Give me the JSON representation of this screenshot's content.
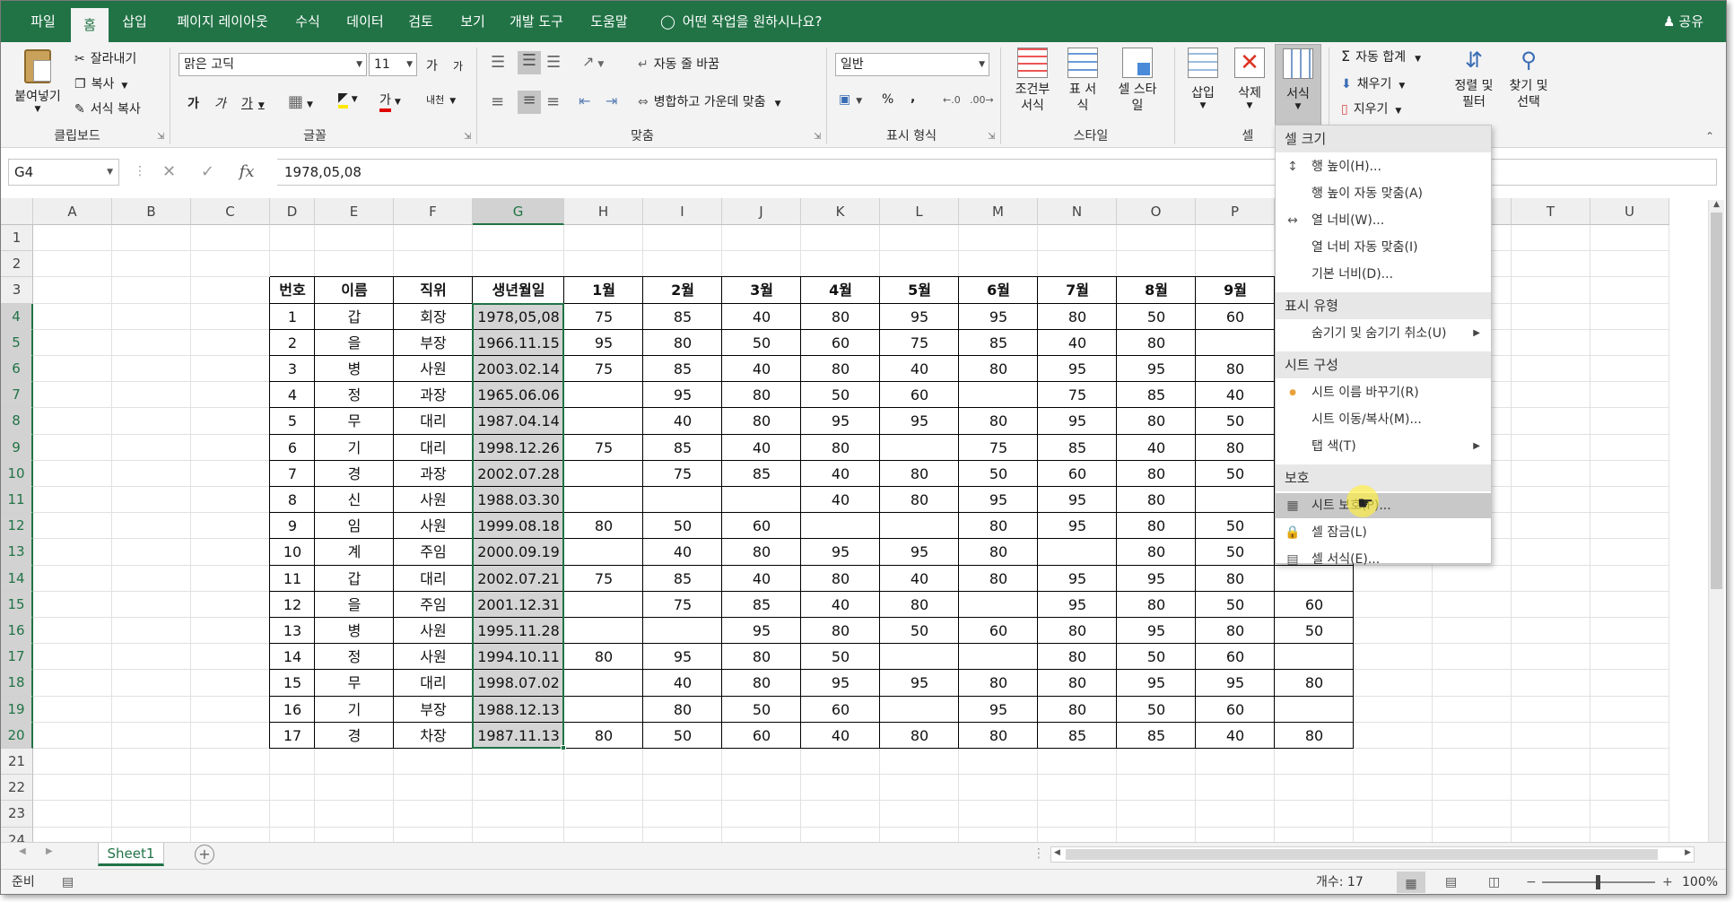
{
  "ribbon_tabs": [
    "파일",
    "홈",
    "삽입",
    "페이지 레이아웃",
    "수식",
    "데이터",
    "검토",
    "보기",
    "개발 도구",
    "도움말"
  ],
  "active_tab": "홈",
  "tell_me": "어떤 작업을 원하시나요?",
  "share": "공유",
  "clipboard": {
    "paste": "붙여넣기",
    "cut": "잘라내기",
    "copy": "복사",
    "format_painter": "서식 복사",
    "label": "클립보드"
  },
  "font": {
    "name": "맑은 고딕",
    "size": "11",
    "inc": "가",
    "dec": "가",
    "bold": "가",
    "italic": "가",
    "underline": "가",
    "phonetic": "내천",
    "label": "글꼴"
  },
  "alignment": {
    "wrap": "자동 줄 바꿈",
    "merge": "병합하고 가운데 맞춤",
    "label": "맞춤"
  },
  "number": {
    "format": "일반",
    "percent": "%",
    "comma": ",",
    "label": "표시 형식"
  },
  "styles": {
    "conditional": "조건부 서식",
    "table": "표 서식",
    "cell": "셀 스타일",
    "label": "스타일"
  },
  "cells": {
    "insert": "삽입",
    "delete": "삭제",
    "format": "서식",
    "label": "셀"
  },
  "editing": {
    "autosum": "자동 합계",
    "fill": "채우기",
    "clear": "지우기",
    "sort": "정렬 및 필터",
    "find": "찾기 및 선택"
  },
  "name_box": "G4",
  "formula_value": "1978,05,08",
  "columns": [
    "A",
    "B",
    "C",
    "D",
    "E",
    "F",
    "G",
    "H",
    "I",
    "J",
    "K",
    "L",
    "M",
    "N",
    "O",
    "P",
    "Q",
    "R",
    "S",
    "T",
    "U"
  ],
  "rows": [
    "1",
    "2",
    "3",
    "4",
    "5",
    "6",
    "7",
    "8",
    "9",
    "10",
    "11",
    "12",
    "13",
    "14",
    "15",
    "16",
    "17",
    "18",
    "19",
    "20",
    "21",
    "22",
    "23",
    "24"
  ],
  "table_headers": [
    "번호",
    "이름",
    "직위",
    "생년월일",
    "1월",
    "2월",
    "3월",
    "4월",
    "5월",
    "6월",
    "7월",
    "8월",
    "9월",
    ""
  ],
  "table_rows": [
    [
      "1",
      "갑",
      "회장",
      "1978,05,08",
      "75",
      "85",
      "40",
      "80",
      "95",
      "95",
      "80",
      "50",
      "60",
      ""
    ],
    [
      "2",
      "을",
      "부장",
      "1966.11.15",
      "95",
      "80",
      "50",
      "60",
      "75",
      "85",
      "40",
      "80",
      "",
      ""
    ],
    [
      "3",
      "병",
      "사원",
      "2003.02.14",
      "75",
      "85",
      "40",
      "80",
      "40",
      "80",
      "95",
      "95",
      "80",
      ""
    ],
    [
      "4",
      "정",
      "과장",
      "1965.06.06",
      "",
      "95",
      "80",
      "50",
      "60",
      "",
      "75",
      "85",
      "40",
      ""
    ],
    [
      "5",
      "무",
      "대리",
      "1987.04.14",
      "",
      "40",
      "80",
      "95",
      "95",
      "80",
      "95",
      "80",
      "50",
      ""
    ],
    [
      "6",
      "기",
      "대리",
      "1998.12.26",
      "75",
      "85",
      "40",
      "80",
      "",
      "75",
      "85",
      "40",
      "80",
      ""
    ],
    [
      "7",
      "경",
      "과장",
      "2002.07.28",
      "",
      "75",
      "85",
      "40",
      "80",
      "50",
      "60",
      "80",
      "50",
      ""
    ],
    [
      "8",
      "신",
      "사원",
      "1988.03.30",
      "",
      "",
      "",
      "40",
      "80",
      "95",
      "95",
      "80",
      "",
      ""
    ],
    [
      "9",
      "임",
      "사원",
      "1999.08.18",
      "80",
      "50",
      "60",
      "",
      "",
      "80",
      "95",
      "80",
      "50",
      ""
    ],
    [
      "10",
      "계",
      "주임",
      "2000.09.19",
      "",
      "40",
      "80",
      "95",
      "95",
      "80",
      "",
      "80",
      "50",
      ""
    ],
    [
      "11",
      "갑",
      "대리",
      "2002.07.21",
      "75",
      "85",
      "40",
      "80",
      "40",
      "80",
      "95",
      "95",
      "80",
      ""
    ],
    [
      "12",
      "을",
      "주임",
      "2001.12.31",
      "",
      "75",
      "85",
      "40",
      "80",
      "",
      "95",
      "80",
      "50",
      "60"
    ],
    [
      "13",
      "병",
      "사원",
      "1995.11.28",
      "",
      "",
      "95",
      "80",
      "50",
      "60",
      "80",
      "95",
      "80",
      "50"
    ],
    [
      "14",
      "정",
      "사원",
      "1994.10.11",
      "80",
      "95",
      "80",
      "50",
      "",
      "",
      "80",
      "50",
      "60",
      ""
    ],
    [
      "15",
      "무",
      "대리",
      "1998.07.02",
      "",
      "40",
      "80",
      "95",
      "95",
      "80",
      "80",
      "95",
      "95",
      "80"
    ],
    [
      "16",
      "기",
      "부장",
      "1988.12.13",
      "",
      "80",
      "50",
      "60",
      "",
      "95",
      "80",
      "50",
      "60",
      ""
    ],
    [
      "17",
      "경",
      "차장",
      "1987.11.13",
      "80",
      "50",
      "60",
      "40",
      "80",
      "80",
      "85",
      "85",
      "40",
      "80"
    ]
  ],
  "format_menu": {
    "sections": [
      {
        "title": "셀 크기",
        "items": [
          {
            "label": "행 높이(H)...",
            "icon": "row-height-icon"
          },
          {
            "label": "행 높이 자동 맞춤(A)",
            "icon": ""
          },
          {
            "label": "열 너비(W)...",
            "icon": "column-width-icon"
          },
          {
            "label": "열 너비 자동 맞춤(I)",
            "icon": ""
          },
          {
            "label": "기본 너비(D)...",
            "icon": ""
          }
        ]
      },
      {
        "title": "표시 유형",
        "items": [
          {
            "label": "숨기기 및 숨기기 취소(U)",
            "icon": "",
            "submenu": true
          }
        ]
      },
      {
        "title": "시트 구성",
        "items": [
          {
            "label": "시트 이름 바꾸기(R)",
            "icon": "dot-icon"
          },
          {
            "label": "시트 이동/복사(M)...",
            "icon": ""
          },
          {
            "label": "탭 색(T)",
            "icon": "",
            "submenu": true
          }
        ]
      },
      {
        "title": "보호",
        "items": [
          {
            "label": "시트 보호(P)...",
            "icon": "protect-sheet-icon",
            "highlight": true
          },
          {
            "label": "셀 잠금(L)",
            "icon": "lock-icon"
          },
          {
            "label": "셀 서식(E)...",
            "icon": "format-cells-icon"
          }
        ]
      }
    ]
  },
  "sheet_tab": "Sheet1",
  "status": {
    "ready": "준비",
    "count": "개수: 17",
    "zoom": "100%"
  },
  "colors": {
    "accent": "#217346",
    "selection": "#d4d4d4"
  }
}
